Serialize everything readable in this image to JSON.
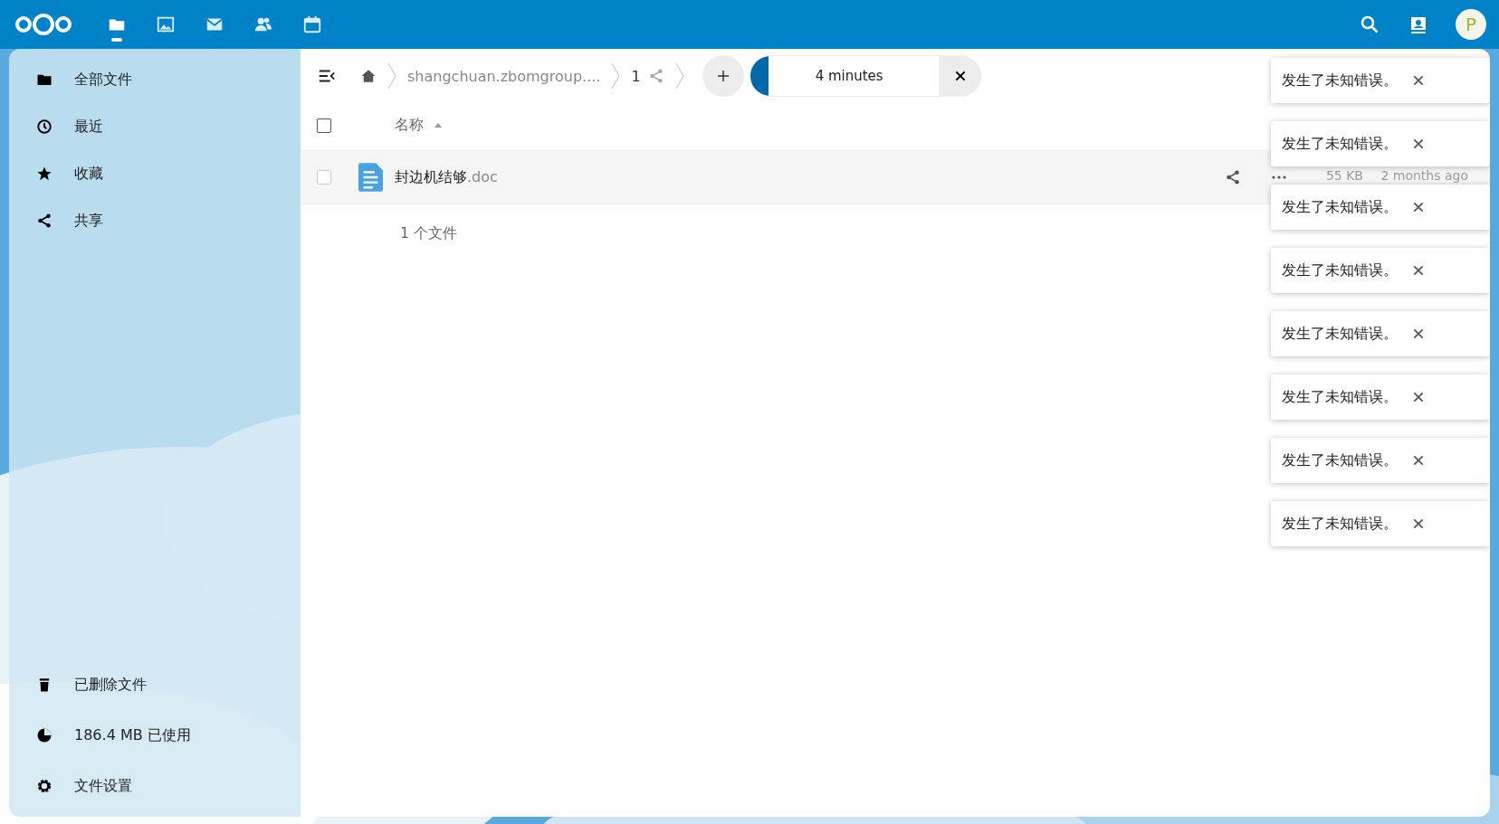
{
  "header": {
    "apps": [
      {
        "selected": true
      },
      {
        "selected": false
      },
      {
        "selected": false
      },
      {
        "selected": false
      },
      {
        "selected": false
      }
    ],
    "avatar": "P"
  },
  "sidebar": {
    "items": [
      {
        "label": "全部文件",
        "selected": false
      },
      {
        "label": "最近",
        "selected": false
      },
      {
        "label": "收藏",
        "selected": false
      },
      {
        "label": "共享",
        "selected": false
      }
    ],
    "footer": [
      {
        "label": "已删除文件"
      },
      {
        "label": "186.4 MB 已使用"
      },
      {
        "label": "文件设置"
      }
    ]
  },
  "breadcrumbs": [
    {
      "label": "shangchuan.zbomgroup...."
    },
    {
      "label": "1"
    }
  ],
  "upload": {
    "level": 0.1,
    "remaining": "4 minutes"
  },
  "table": {
    "all_checked": false,
    "name_column": "名称",
    "rows": [
      {
        "name": "封边机结够",
        "ext": ".doc",
        "checked": false,
        "size": "55 KB",
        "modified": "2 months ago"
      }
    ],
    "summary": "1 个文件"
  },
  "toasts": [
    "发生了未知错误。",
    "发生了未知错误。",
    "发生了未知错误。",
    "发生了未知错误。",
    "发生了未知错误。",
    "发生了未知错误。",
    "发生了未知错误。",
    "发生了未知错误。"
  ]
}
